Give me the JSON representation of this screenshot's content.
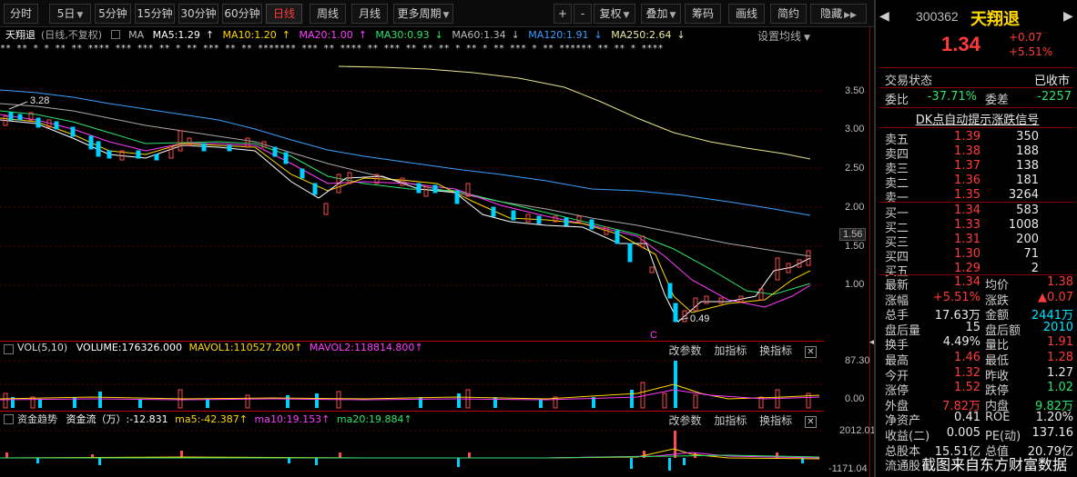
{
  "toolbar": {
    "left": [
      "分时",
      "5日",
      "5分钟",
      "15分钟",
      "30分钟",
      "60分钟",
      "日线",
      "周线",
      "月线",
      "更多周期"
    ],
    "right": [
      "+",
      "-",
      "复权",
      "叠加",
      "筹码",
      "画线",
      "简约",
      "隐藏"
    ]
  },
  "main": {
    "name": "天翔退",
    "period": "(日线,不复权)",
    "ma_label": "MA",
    "ma5": "MA5:1.29",
    "ma10": "MA10:1.20",
    "ma20": "MA20:1.00",
    "ma30": "MA30:0.93",
    "ma60": "MA60:1.34",
    "ma120": "MA120:1.91",
    "ma250": "MA250:2.64",
    "setting": "设置均线",
    "high_label": "3.28",
    "low_label": "0.49",
    "c_mark": "C",
    "price_axis": [
      "3.50",
      "3.00",
      "2.50",
      "2.00",
      "1.56",
      "1.50",
      "1.00"
    ],
    "signal_row": "** ** *  *   ** ** **** *** *** ** *  ** *** **  ** ******* ***  ** ****  ** *** ** ** ** *  ** * ** ***  *  **  ****** ** **  *  ****"
  },
  "volume": {
    "title": "VOL(5,10)",
    "volume": "VOLUME:176326.000",
    "mavol1": "MAVOL1:110527.200",
    "mavol2": "MAVOL2:118814.800",
    "btn_params": "改参数",
    "btn_add": "加指标",
    "btn_switch": "换指标",
    "axis_top": "87.30",
    "axis_bottom": "0.00"
  },
  "fund": {
    "title": "资金趋势",
    "flow": "资金流（万）:-12.831",
    "ma5": "ma5:-42.387",
    "ma10": "ma10:19.153",
    "ma20": "ma20:19.884",
    "btn_params": "改参数",
    "btn_add": "加指标",
    "btn_switch": "换指标",
    "axis_top": "2012.01",
    "axis_bottom": "-1171.04"
  },
  "quote": {
    "code": "300362",
    "name": "天翔退",
    "price": "1.34",
    "change": "+0.07",
    "change_pct": "+5.51%",
    "status_label": "交易状态",
    "status_value": "已收市",
    "weibi_label": "委比",
    "weibi_value": "-37.71%",
    "weicha_label": "委差",
    "weicha_value": "-2257",
    "dk_signal": "DK点自动提示涨跌信号",
    "asks": [
      {
        "label": "卖五",
        "price": "1.39",
        "vol": "350"
      },
      {
        "label": "卖四",
        "price": "1.38",
        "vol": "188"
      },
      {
        "label": "卖三",
        "price": "1.37",
        "vol": "138"
      },
      {
        "label": "卖二",
        "price": "1.36",
        "vol": "181"
      },
      {
        "label": "卖一",
        "price": "1.35",
        "vol": "3264"
      }
    ],
    "bids": [
      {
        "label": "买一",
        "price": "1.34",
        "vol": "583"
      },
      {
        "label": "买二",
        "price": "1.33",
        "vol": "1008"
      },
      {
        "label": "买三",
        "price": "1.31",
        "vol": "200"
      },
      {
        "label": "买四",
        "price": "1.30",
        "vol": "71"
      },
      {
        "label": "买五",
        "price": "1.29",
        "vol": "2"
      }
    ],
    "stats": [
      {
        "l1": "最新",
        "v1": "1.34",
        "c1": "red",
        "l2": "均价",
        "v2": "1.38",
        "c2": "red"
      },
      {
        "l1": "涨幅",
        "v1": "+5.51%",
        "c1": "red",
        "l2": "涨跌",
        "v2": "▲0.07",
        "c2": "red"
      },
      {
        "l1": "总手",
        "v1": "17.63万",
        "c1": "white",
        "l2": "金额",
        "v2": "2441万",
        "c2": "cyan"
      },
      {
        "l1": "盘后量",
        "v1": "15",
        "c1": "white",
        "l2": "盘后额",
        "v2": "2010",
        "c2": "cyan"
      },
      {
        "l1": "换手",
        "v1": "4.49%",
        "c1": "white",
        "l2": "量比",
        "v2": "1.91",
        "c2": "red"
      },
      {
        "l1": "最高",
        "v1": "1.46",
        "c1": "red",
        "l2": "最低",
        "v2": "1.28",
        "c2": "red"
      },
      {
        "l1": "今开",
        "v1": "1.32",
        "c1": "red",
        "l2": "昨收",
        "v2": "1.27",
        "c2": "white"
      },
      {
        "l1": "涨停",
        "v1": "1.52",
        "c1": "red",
        "l2": "跌停",
        "v2": "1.02",
        "c2": "green"
      },
      {
        "l1": "外盘",
        "v1": "7.82万",
        "c1": "red",
        "l2": "内盘",
        "v2": "9.82万",
        "c2": "green"
      },
      {
        "l1": "净资产",
        "v1": "0.41",
        "c1": "white",
        "l2": "ROE",
        "v2": "1.20%",
        "c2": "white"
      },
      {
        "l1": "收益(二)",
        "v1": "0.005",
        "c1": "white",
        "l2": "PE(动)",
        "v2": "137.16",
        "c2": "white"
      },
      {
        "l1": "总股本",
        "v1": "15.51亿",
        "c1": "white",
        "l2": "总值",
        "v2": "20.79亿",
        "c2": "white"
      },
      {
        "l1": "流通股",
        "v1": "",
        "c1": "white",
        "l2": "",
        "v2": "",
        "c2": "white"
      }
    ]
  },
  "watermark": "截图来自东方财富数据"
}
